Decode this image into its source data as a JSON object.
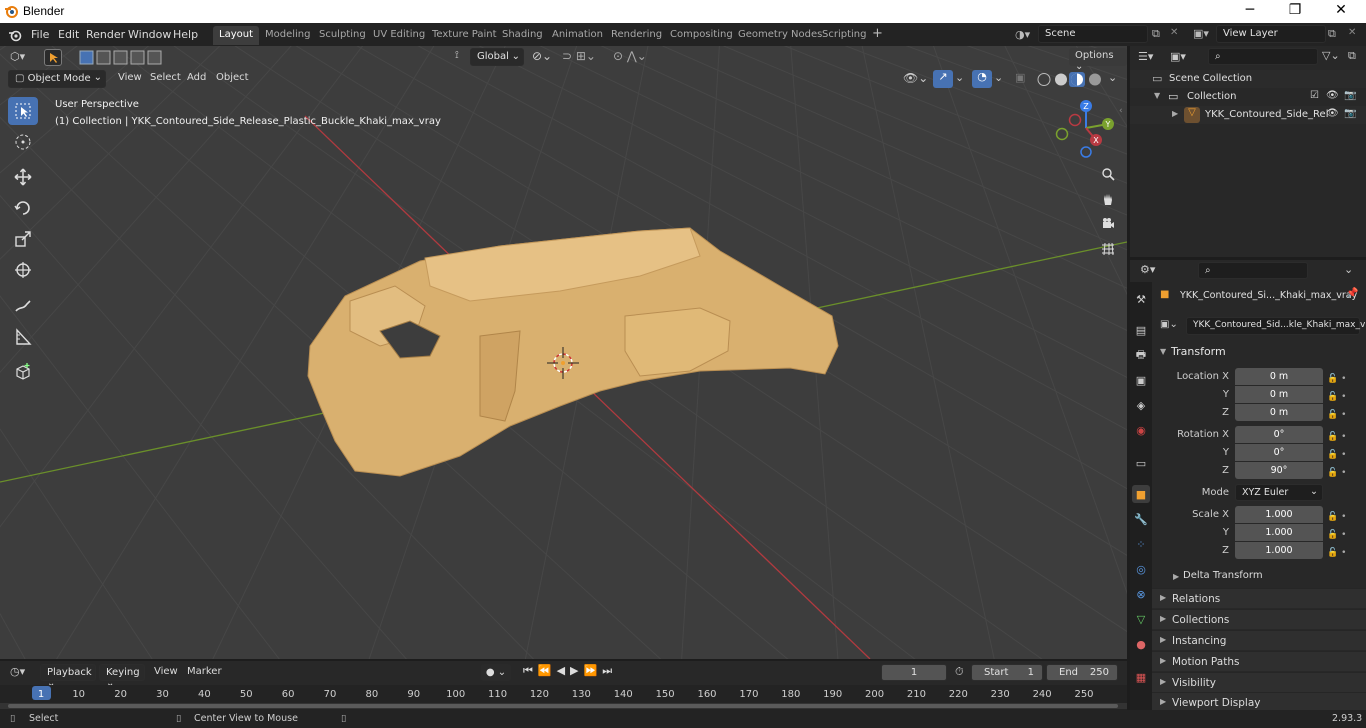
{
  "window": {
    "title": "Blender",
    "minimize": "─",
    "maximize": "❐",
    "close": "✕"
  },
  "menu": [
    "File",
    "Edit",
    "Render",
    "Window",
    "Help"
  ],
  "workspaces": [
    "Layout",
    "Modeling",
    "Sculpting",
    "UV Editing",
    "Texture Paint",
    "Shading",
    "Animation",
    "Rendering",
    "Compositing",
    "Geometry Nodes",
    "Scripting"
  ],
  "active_workspace": "Layout",
  "scene": {
    "name": "Scene",
    "view_layer": "View Layer"
  },
  "viewport": {
    "mode": "Object Mode",
    "menus": [
      "View",
      "Select",
      "Add",
      "Object"
    ],
    "orientation": "Global",
    "options_label": "Options",
    "perspective_label": "User Perspective",
    "collection_label": "(1) Collection | YKK_Contoured_Side_Release_Plastic_Buckle_Khaki_max_vray",
    "gizmo_axes": {
      "x": "X",
      "y": "Y",
      "z": "Z"
    },
    "object_color": "#d9b06f"
  },
  "outliner": {
    "root": "Scene Collection",
    "collection": "Collection",
    "object": "YKK_Contoured_Side_Rel"
  },
  "properties": {
    "object_name": "YKK_Contoured_Si..._Khaki_max_vray",
    "mesh_name": "YKK_Contoured_Sid...kle_Khaki_max_vray",
    "transform_title": "Transform",
    "location_label": "Location X",
    "rotation_label": "Rotation X",
    "scale_label": "Scale X",
    "y_label": "Y",
    "z_label": "Z",
    "location": [
      "0 m",
      "0 m",
      "0 m"
    ],
    "rotation": [
      "0°",
      "0°",
      "90°"
    ],
    "mode_label": "Mode",
    "mode_value": "XYZ Euler",
    "scale": [
      "1.000",
      "1.000",
      "1.000"
    ],
    "delta_transform": "Delta Transform",
    "panels": [
      "Relations",
      "Collections",
      "Instancing",
      "Motion Paths",
      "Visibility",
      "Viewport Display"
    ]
  },
  "timeline": {
    "menus": [
      "Playback",
      "Keying",
      "View",
      "Marker"
    ],
    "current_frame": "1",
    "start_label": "Start",
    "start": "1",
    "end_label": "End",
    "end": "250",
    "ruler_ticks": [
      "1",
      "10",
      "20",
      "30",
      "40",
      "50",
      "60",
      "70",
      "80",
      "90",
      "100",
      "110",
      "120",
      "130",
      "140",
      "150",
      "160",
      "170",
      "180",
      "190",
      "200",
      "210",
      "220",
      "230",
      "240",
      "250"
    ]
  },
  "status": {
    "select": "Select",
    "center_view": "Center View to Mouse",
    "version": "2.93.3"
  },
  "colors": {
    "accent": "#4772b3",
    "x_axis": "#b83a42",
    "y_axis": "#7aa12e",
    "z_axis": "#3a7ce6"
  }
}
